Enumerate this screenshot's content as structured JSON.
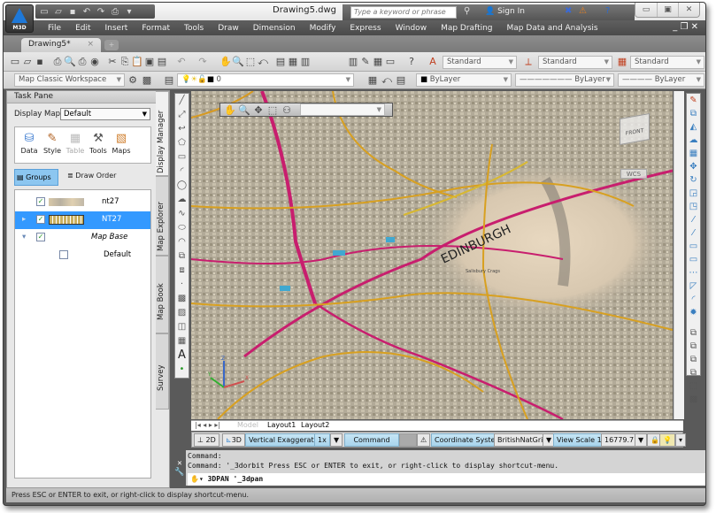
{
  "app": {
    "badge": "M3D",
    "title": "Drawing5.dwg",
    "search_placeholder": "Type a keyword or phrase",
    "sign_in": "Sign In"
  },
  "menu": [
    "File",
    "Edit",
    "Insert",
    "Format",
    "Tools",
    "Draw",
    "Dimension",
    "Modify",
    "Express",
    "Window",
    "Map Drafting",
    "Map Data and Analysis"
  ],
  "doc_tab": {
    "label": "Drawing5*",
    "close": "×"
  },
  "toolbar": {
    "workspace": "Map Classic Workspace",
    "layer": "0",
    "text_style": "Standard",
    "dim_style": "Standard",
    "table_style": "Standard",
    "color": "ByLayer",
    "linetype": "ByLayer",
    "lineweight": "ByLayer"
  },
  "taskpane": {
    "title": "Task Pane",
    "display_map_label": "Display Map:",
    "display_map_value": "Default",
    "ribbon": [
      {
        "icon": "database-icon",
        "label": "Data",
        "glyph": "⛁"
      },
      {
        "icon": "brush-icon",
        "label": "Style",
        "glyph": "✎"
      },
      {
        "icon": "table-icon",
        "label": "Table",
        "glyph": "▦"
      },
      {
        "icon": "tools-icon",
        "label": "Tools",
        "glyph": "⚒"
      },
      {
        "icon": "maps-icon",
        "label": "Maps",
        "glyph": "▧"
      }
    ],
    "groups_label": "Groups",
    "draw_order_label": "Draw Order",
    "layers": [
      {
        "name": "nt27",
        "checked": true,
        "selected": false,
        "italic": false
      },
      {
        "name": "NT27",
        "checked": true,
        "selected": true,
        "italic": false
      },
      {
        "name": "Map Base",
        "checked": true,
        "selected": false,
        "italic": true
      },
      {
        "name": "Default",
        "checked": false,
        "selected": false,
        "italic": false
      }
    ],
    "side_tabs": [
      "Display Manager",
      "Map Explorer",
      "Map Book",
      "Survey"
    ]
  },
  "viewport": {
    "wcs": "WCS",
    "navcube_face": "FRONT",
    "map_label": "EDINBURGH",
    "map_sublabel": "Salisbury Crags",
    "orbit_combo": ""
  },
  "layout_tabs": [
    "Model",
    "Layout1",
    "Layout2"
  ],
  "status": {
    "btn_2d": "2D",
    "btn_3d": "3D",
    "vert_exag_label": "Vertical Exaggeration:",
    "vert_exag_value": "1x",
    "command": "Command",
    "coord_label": "Coordinate System:",
    "coord_value": "BritishNatGrid",
    "view_scale_label": "View Scale",
    "view_scale_prefix": "1 :",
    "view_scale_value": "16779.7"
  },
  "command_line": {
    "line1": "Command:",
    "line2": "Command: '_3dorbit Press ESC or ENTER to exit, or right-click to display shortcut-menu.",
    "input": "3DPAN '_3dpan"
  },
  "statusbar": "Press ESC or ENTER to exit, or right-click to display shortcut-menu.",
  "colors": {
    "accent": "#1e78d8",
    "selected_row": "#3399ff",
    "status_blue": "#b8def2"
  }
}
